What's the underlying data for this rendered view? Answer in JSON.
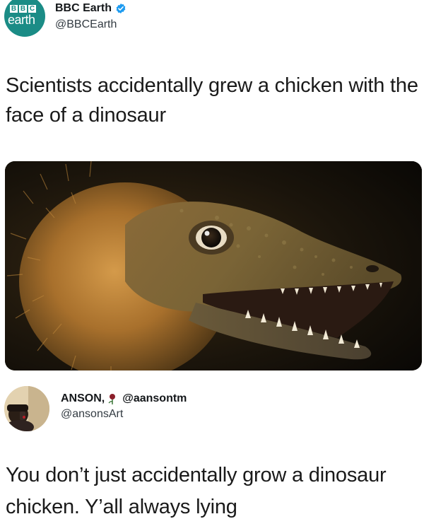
{
  "tweet": {
    "avatar": {
      "logo_letters": [
        "B",
        "B",
        "C"
      ],
      "logo_word": "earth",
      "color": "#1b8c86"
    },
    "display_name": "BBC Earth",
    "verified": true,
    "handle": "@BBCEarth",
    "text": "Scientists accidentally grew a chicken with the face of a dinosaur",
    "image": {
      "subject": "dinosaur-faced chicken"
    }
  },
  "reply": {
    "display_name": "ANSON,",
    "name_icon": "rose-icon",
    "alt_handle": "@aansontm",
    "handle": "@ansonsArt",
    "text": "You don’t just accidentally grow a dinosaur chicken. Y’all always lying"
  },
  "colors": {
    "verified_blue": "#1d9bf0",
    "text": "#1a1a1a",
    "handle_gray": "#333b42"
  }
}
